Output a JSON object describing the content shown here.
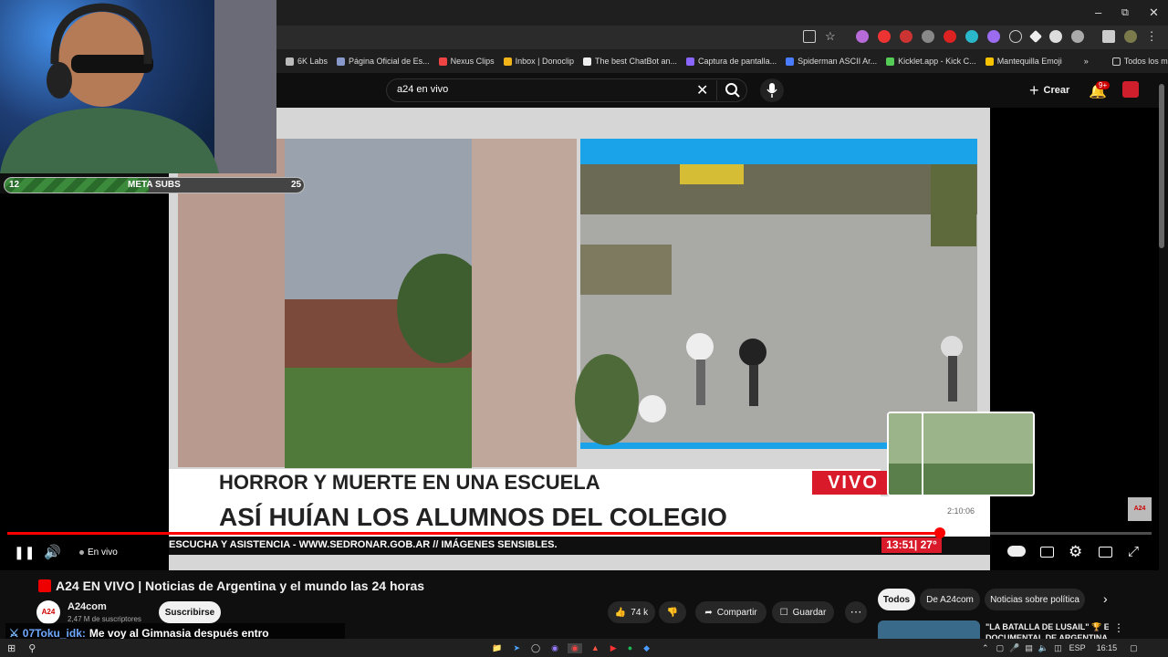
{
  "browser": {
    "bookmarks": [
      {
        "label": "6K Labs",
        "color": "#bbbbbb"
      },
      {
        "label": "Página Oficial de Es...",
        "color": "#8899cc"
      },
      {
        "label": "Nexus Clips",
        "color": "#e44"
      },
      {
        "label": "Inbox | Donoclip",
        "color": "#f3b41a"
      },
      {
        "label": "The best ChatBot an...",
        "color": "#eee"
      },
      {
        "label": "Captura de pantalla...",
        "color": "#8a66ff"
      },
      {
        "label": "Spiderman ASCII Ar...",
        "color": "#4a7cff"
      },
      {
        "label": "Kicklet.app - Kick C...",
        "color": "#5c5"
      },
      {
        "label": "Mantequilla Emoji",
        "color": "#f7c200"
      }
    ],
    "bookmarks_more": "»",
    "all_bookmarks": "Todos los marcadores"
  },
  "youtube": {
    "search_query": "a24 en vivo",
    "create_label": "Crear",
    "notifications_badge": "9+"
  },
  "overlay": {
    "sub_goal": {
      "label": "META SUBS",
      "current": "12",
      "target": "25",
      "fraction": 0.48
    }
  },
  "video": {
    "headline_small": "HORROR Y MUERTE EN UNA ESCUELA",
    "headline_big": "ASÍ HUÍAN LOS ALUMNOS DEL COLEGIO",
    "vivo_label": "VIVO",
    "ticker": "ESCUCHA Y ASISTENCIA - WWW.SEDRONAR.GOB.AR // IMÁGENES SENSIBLES.",
    "ticker_time": "13:51",
    "ticker_temp": "27°",
    "hover_time": "2:10:06",
    "brand_badge": "A24",
    "progress_fraction": 0.815
  },
  "player": {
    "live_label": "En vivo"
  },
  "meta": {
    "title": "A24 EN VIVO | Noticias de Argentina y el mundo las 24 horas",
    "channel_name": "A24com",
    "channel_logo": "A24",
    "subscribers": "2,47 M de suscriptores",
    "subscribe_label": "Suscribirse",
    "likes": "74 k",
    "share_label": "Compartir",
    "save_label": "Guardar"
  },
  "filters": [
    "Todos",
    "De A24com",
    "Noticias sobre política"
  ],
  "recommended": {
    "title_line1": "\"LA BATALLA DE LUSAIL\" 🏆 El",
    "title_line2": "DOCUMENTAL DE ARGENTINA"
  },
  "chat": {
    "username": "07Toku_idk:",
    "message": "Me voy al Gimnasia después entro"
  },
  "taskbar": {
    "lang": "ESP",
    "time": "16:15"
  }
}
